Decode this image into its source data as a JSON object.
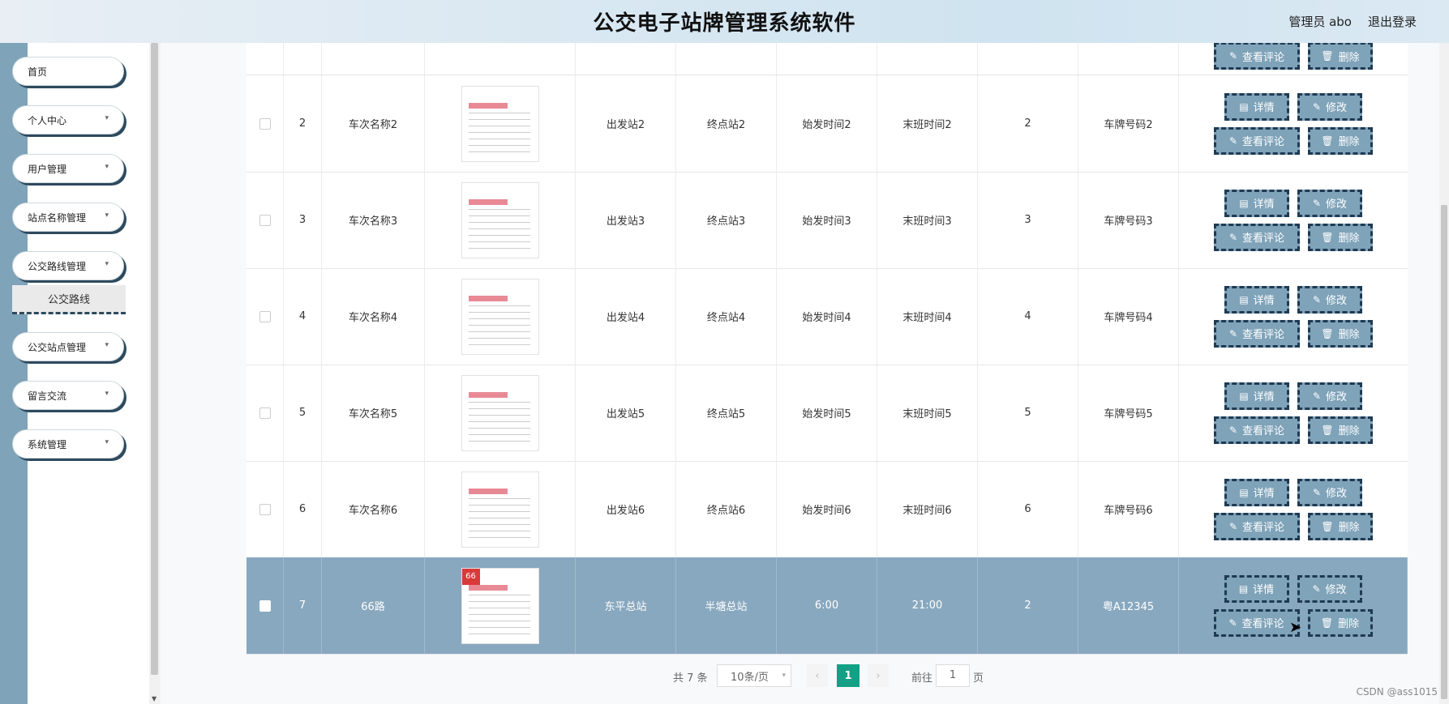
{
  "header": {
    "title": "公交电子站牌管理系统软件",
    "user": "管理员 abo",
    "logout": "退出登录"
  },
  "sidebar": {
    "items": [
      {
        "label": "首页"
      },
      {
        "label": "个人中心"
      },
      {
        "label": "用户管理"
      },
      {
        "label": "站点名称管理"
      },
      {
        "label": "公交路线管理"
      },
      {
        "label": "公交站点管理"
      },
      {
        "label": "留言交流"
      },
      {
        "label": "系统管理"
      }
    ],
    "submenu": "公交路线"
  },
  "table": {
    "rows": [
      {
        "id": "2",
        "name": "车次名称2",
        "start": "出发站2",
        "end": "终点站2",
        "first": "始发时间2",
        "last": "末班时间2",
        "num": "2",
        "plate": "车牌号码2"
      },
      {
        "id": "3",
        "name": "车次名称3",
        "start": "出发站3",
        "end": "终点站3",
        "first": "始发时间3",
        "last": "末班时间3",
        "num": "3",
        "plate": "车牌号码3"
      },
      {
        "id": "4",
        "name": "车次名称4",
        "start": "出发站4",
        "end": "终点站4",
        "first": "始发时间4",
        "last": "末班时间4",
        "num": "4",
        "plate": "车牌号码4"
      },
      {
        "id": "5",
        "name": "车次名称5",
        "start": "出发站5",
        "end": "终点站5",
        "first": "始发时间5",
        "last": "末班时间5",
        "num": "5",
        "plate": "车牌号码5"
      },
      {
        "id": "6",
        "name": "车次名称6",
        "start": "出发站6",
        "end": "终点站6",
        "first": "始发时间6",
        "last": "末班时间6",
        "num": "6",
        "plate": "车牌号码6"
      },
      {
        "id": "7",
        "name": "66路",
        "start": "东平总站",
        "end": "半塘总站",
        "first": "6:00",
        "last": "21:00",
        "num": "2",
        "plate": "粤A12345",
        "badge": "66"
      }
    ],
    "actions": {
      "detail": "详情",
      "edit": "修改",
      "comments": "查看评论",
      "delete": "删除"
    }
  },
  "pager": {
    "total": "共 7 条",
    "size": "10条/页",
    "current": "1",
    "goto": "前往",
    "goto_value": "1",
    "unit": "页"
  },
  "watermark": "CSDN @ass1015"
}
